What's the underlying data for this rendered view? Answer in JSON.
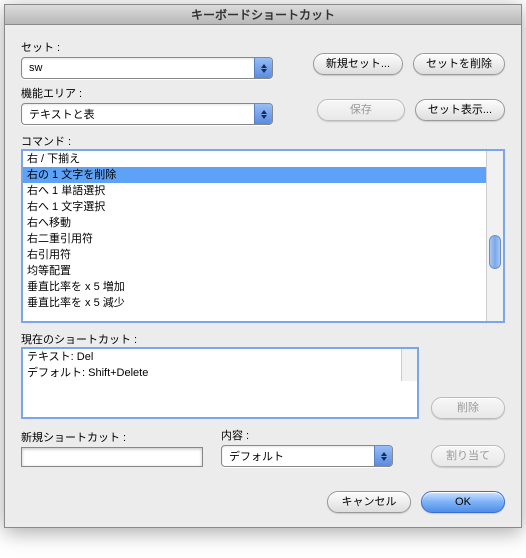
{
  "title": "キーボードショートカット",
  "set": {
    "label": "セット :",
    "value": "sw"
  },
  "buttons": {
    "newSet": "新規セット...",
    "deleteSet": "セットを削除",
    "save": "保存",
    "showSet": "セット表示...",
    "delete": "削除",
    "assign": "割り当て",
    "cancel": "キャンセル",
    "ok": "OK"
  },
  "area": {
    "label": "機能エリア :",
    "value": "テキストと表"
  },
  "commands": {
    "label": "コマンド :",
    "items": [
      "右 / 下揃え",
      "右の 1 文字を削除",
      "右へ 1 単語選択",
      "右へ 1 文字選択",
      "右へ移動",
      "右二重引用符",
      "右引用符",
      "均等配置",
      "垂直比率を x 5 増加",
      "垂直比率を x 5 減少"
    ],
    "selectedIndex": 1
  },
  "current": {
    "label": "現在のショートカット :",
    "items": [
      "テキスト: Del",
      "デフォルト: Shift+Delete"
    ]
  },
  "newShortcut": {
    "label": "新規ショートカット :",
    "value": ""
  },
  "context": {
    "label": "内容 :",
    "value": "デフォルト"
  }
}
